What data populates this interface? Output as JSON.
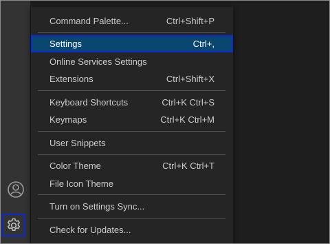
{
  "menu": {
    "items": [
      {
        "label": "Command Palette...",
        "shortcut": "Ctrl+Shift+P"
      },
      {
        "label": "Settings",
        "shortcut": "Ctrl+,"
      },
      {
        "label": "Online Services Settings",
        "shortcut": ""
      },
      {
        "label": "Extensions",
        "shortcut": "Ctrl+Shift+X"
      },
      {
        "label": "Keyboard Shortcuts",
        "shortcut": "Ctrl+K Ctrl+S"
      },
      {
        "label": "Keymaps",
        "shortcut": "Ctrl+K Ctrl+M"
      },
      {
        "label": "User Snippets",
        "shortcut": ""
      },
      {
        "label": "Color Theme",
        "shortcut": "Ctrl+K Ctrl+T"
      },
      {
        "label": "File Icon Theme",
        "shortcut": ""
      },
      {
        "label": "Turn on Settings Sync...",
        "shortcut": ""
      },
      {
        "label": "Check for Updates...",
        "shortcut": ""
      }
    ]
  },
  "activity_bar": {
    "icons": [
      "accounts-icon",
      "gear-icon"
    ]
  },
  "colors": {
    "selection_bg": "#094771",
    "highlight_border": "#0b2bd2",
    "menu_bg": "#252526",
    "activity_bar_bg": "#333333"
  }
}
